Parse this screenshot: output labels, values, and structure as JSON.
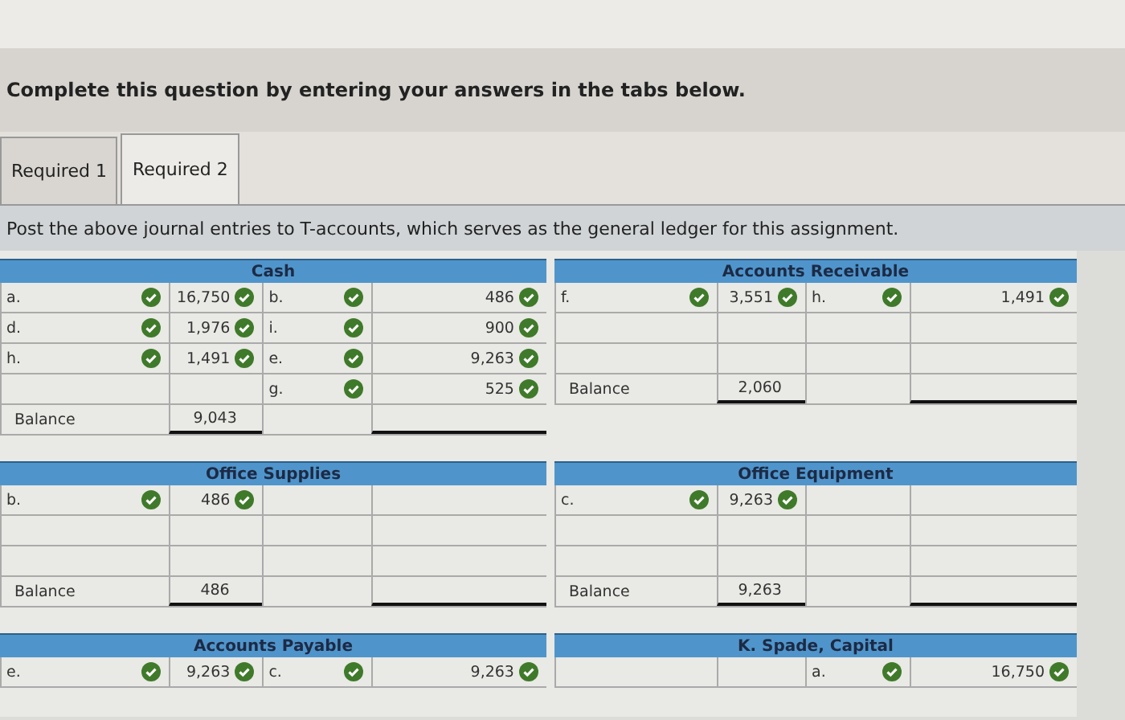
{
  "instruction": "Complete this question by entering your answers in the tabs below.",
  "tabs": [
    {
      "label": "Required 1",
      "selected": false
    },
    {
      "label": "Required 2",
      "selected": true
    }
  ],
  "prompt": "Post the above journal entries to T-accounts, which serves as the general ledger for this assignment.",
  "accounts": [
    {
      "title": "Cash",
      "rows": [
        {
          "kind": "entry",
          "debit": {
            "label": "a.",
            "label_checked": true,
            "amount": "16,750",
            "amount_checked": true
          },
          "credit": {
            "label": "b.",
            "label_checked": true,
            "amount": "486",
            "amount_checked": true
          }
        },
        {
          "kind": "entry",
          "debit": {
            "label": "d.",
            "label_checked": true,
            "amount": "1,976",
            "amount_checked": true
          },
          "credit": {
            "label": "i.",
            "label_checked": true,
            "amount": "900",
            "amount_checked": true
          }
        },
        {
          "kind": "entry",
          "debit": {
            "label": "h.",
            "label_checked": true,
            "amount": "1,491",
            "amount_checked": true
          },
          "credit": {
            "label": "e.",
            "label_checked": true,
            "amount": "9,263",
            "amount_checked": true
          }
        },
        {
          "kind": "entry",
          "credit": {
            "label": "g.",
            "label_checked": true,
            "amount": "525",
            "amount_checked": true
          }
        },
        {
          "kind": "balance",
          "label": "Balance",
          "amount": "9,043"
        }
      ]
    },
    {
      "title": "Accounts Receivable",
      "rows": [
        {
          "kind": "entry",
          "debit": {
            "label": "f.",
            "label_checked": true,
            "amount": "3,551",
            "amount_checked": true
          },
          "credit": {
            "label": "h.",
            "label_checked": true,
            "amount": "1,491",
            "amount_checked": true
          }
        },
        {
          "kind": "blank"
        },
        {
          "kind": "blank"
        },
        {
          "kind": "balance",
          "label": "Balance",
          "amount": "2,060"
        }
      ]
    },
    {
      "title": "Office Supplies",
      "rows": [
        {
          "kind": "entry",
          "debit": {
            "label": "b.",
            "label_checked": true,
            "amount": "486",
            "amount_checked": true
          }
        },
        {
          "kind": "blank"
        },
        {
          "kind": "blank"
        },
        {
          "kind": "balance",
          "label": "Balance",
          "amount": "486"
        }
      ]
    },
    {
      "title": "Office Equipment",
      "rows": [
        {
          "kind": "entry",
          "debit": {
            "label": "c.",
            "label_checked": true,
            "amount": "9,263",
            "amount_checked": true
          }
        },
        {
          "kind": "blank"
        },
        {
          "kind": "blank"
        },
        {
          "kind": "balance",
          "label": "Balance",
          "amount": "9,263"
        }
      ]
    },
    {
      "title": "Accounts Payable",
      "rows": [
        {
          "kind": "entry",
          "debit": {
            "label": "e.",
            "label_checked": true,
            "amount": "9,263",
            "amount_checked": true
          },
          "credit": {
            "label": "c.",
            "label_checked": true,
            "amount": "9,263",
            "amount_checked": true
          }
        }
      ]
    },
    {
      "title": "K. Spade, Capital",
      "rows": [
        {
          "kind": "entry",
          "credit": {
            "label": "a.",
            "label_checked": true,
            "amount": "16,750",
            "amount_checked": true
          }
        }
      ]
    }
  ]
}
